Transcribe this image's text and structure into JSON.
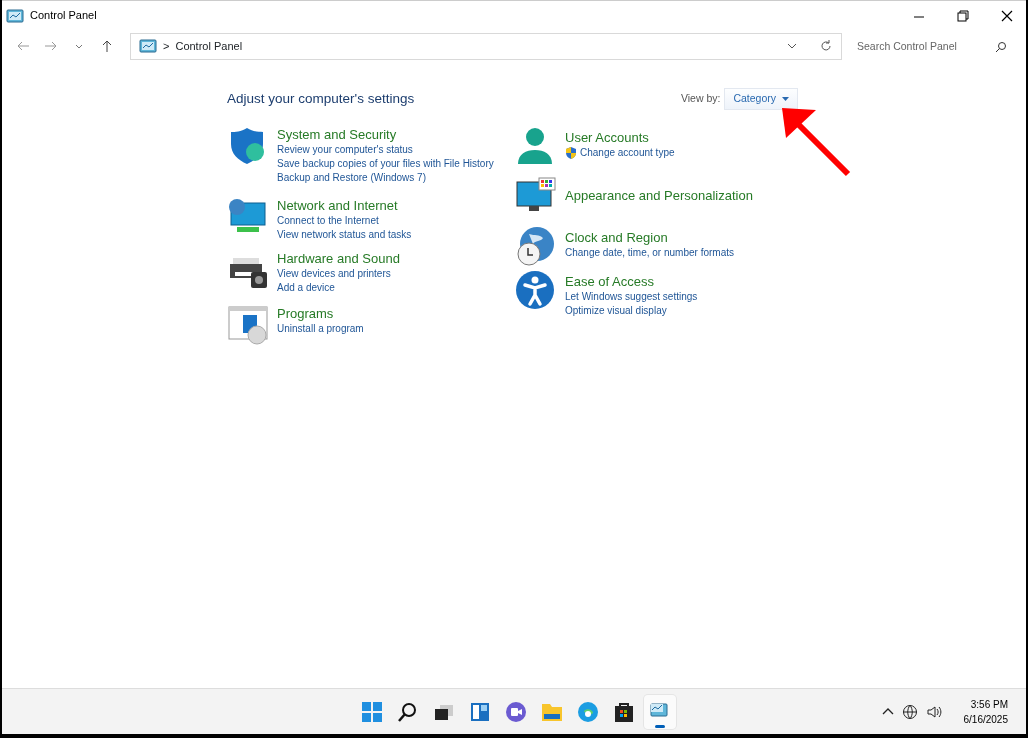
{
  "window": {
    "title": "Control Panel"
  },
  "address_bar": {
    "path": "Control Panel",
    "separator": ">"
  },
  "search": {
    "placeholder": "Search Control Panel"
  },
  "heading": "Adjust your computer's settings",
  "view_by": {
    "label": "View by:",
    "value": "Category"
  },
  "columns": [
    [
      {
        "title": "System and Security",
        "links": [
          {
            "text": "Review your computer's status",
            "shield": false
          },
          {
            "text": "Save backup copies of your files with File History",
            "shield": false
          },
          {
            "text": "Backup and Restore (Windows 7)",
            "shield": false
          }
        ]
      },
      {
        "title": "Network and Internet",
        "links": [
          {
            "text": "Connect to the Internet",
            "shield": false
          },
          {
            "text": "View network status and tasks",
            "shield": false
          }
        ]
      },
      {
        "title": "Hardware and Sound",
        "links": [
          {
            "text": "View devices and printers",
            "shield": false
          },
          {
            "text": "Add a device",
            "shield": false
          }
        ]
      },
      {
        "title": "Programs",
        "links": [
          {
            "text": "Uninstall a program",
            "shield": false
          }
        ]
      }
    ],
    [
      {
        "title": "User Accounts",
        "links": [
          {
            "text": "Change account type",
            "shield": true
          }
        ]
      },
      {
        "title": "Appearance and Personalization"
      },
      {
        "title": "Clock and Region",
        "links": [
          {
            "text": "Change date, time, or number formats",
            "shield": false
          }
        ]
      },
      {
        "title": "Ease of Access",
        "links": [
          {
            "text": "Let Windows suggest settings",
            "shield": false
          },
          {
            "text": "Optimize visual display",
            "shield": false
          }
        ]
      }
    ]
  ],
  "taskbar": {
    "apps": [
      {
        "selected": false
      },
      {
        "selected": false
      },
      {
        "selected": false
      },
      {
        "selected": false
      },
      {
        "selected": false
      },
      {
        "selected": false
      },
      {
        "selected": false
      },
      {
        "selected": false
      },
      {
        "selected": true
      }
    ]
  },
  "clock": {
    "time": "3:56 PM",
    "date": "6/16/2025"
  }
}
